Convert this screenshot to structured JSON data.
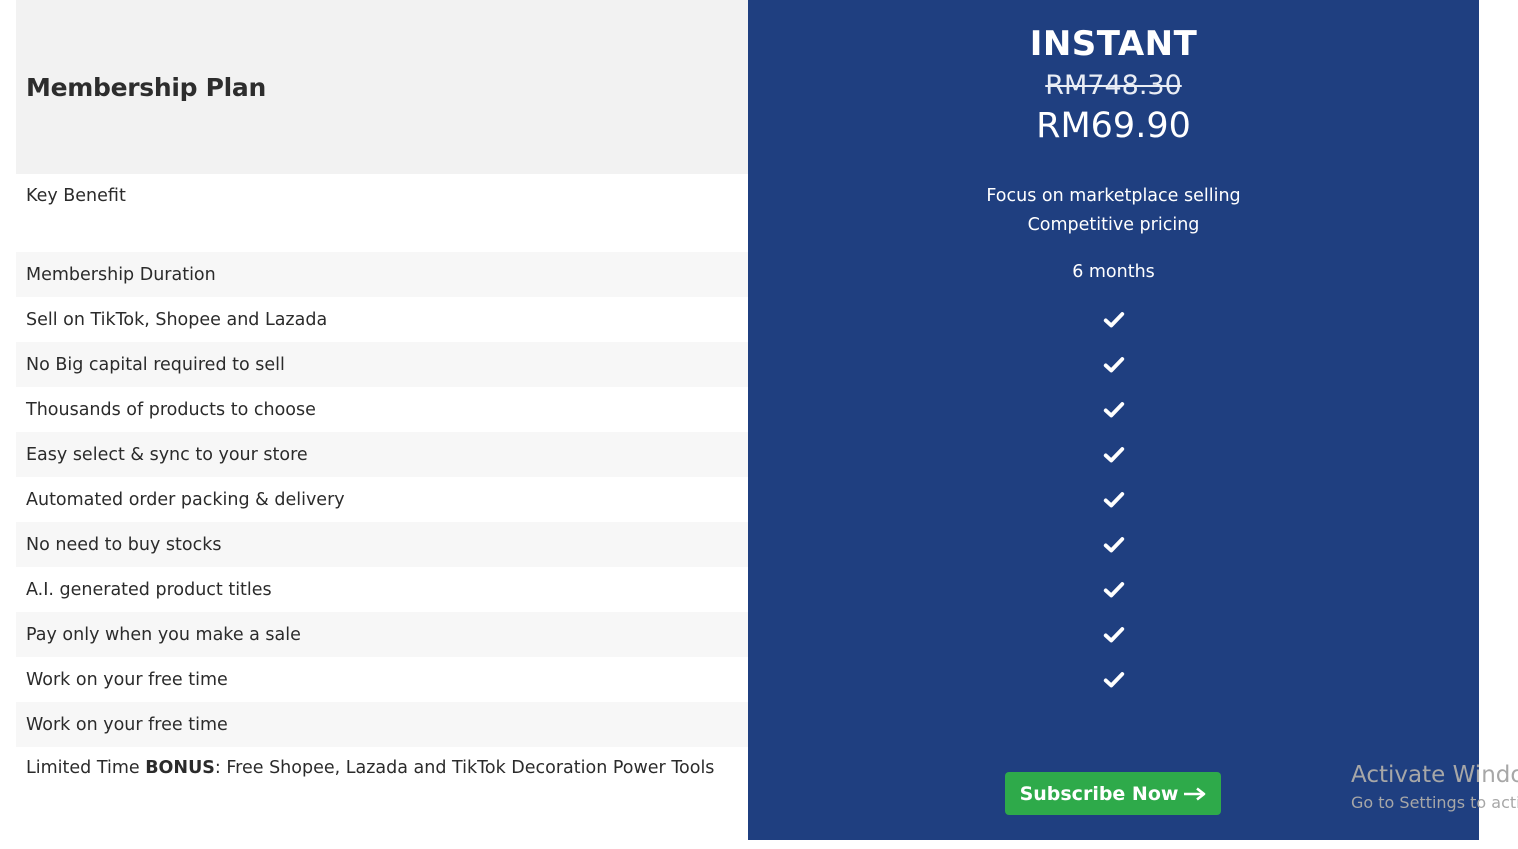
{
  "table": {
    "header_label": "Membership Plan",
    "key_benefit_label": "Key Benefit",
    "duration_label": "Membership Duration",
    "features": [
      "Sell on TikTok, Shopee and Lazada",
      "No Big capital required to sell",
      "Thousands of products to choose",
      "Easy select & sync to your store",
      "Automated order packing & delivery",
      "No need to buy stocks",
      "A.I. generated product titles",
      "Pay only when you make a sale",
      "Work on your free time",
      "Work on your free time"
    ],
    "bonus": {
      "prefix": "Limited Time ",
      "bold": "BONUS",
      "suffix": ": Free Shopee, Lazada and TikTok Decoration Power Tools"
    }
  },
  "plan": {
    "name": "INSTANT",
    "old_price": "RM748.30",
    "price": "RM69.90",
    "benefits": [
      "Focus on marketplace selling",
      "Competitive pricing"
    ],
    "duration": "6 months",
    "included_count": 9,
    "cta_label": "Subscribe Now",
    "colors": {
      "panel": "#1f3f80",
      "button": "#2eaa4a"
    }
  },
  "watermark": {
    "title": "Activate Windo",
    "subtitle": "Go to Settings to acti"
  }
}
